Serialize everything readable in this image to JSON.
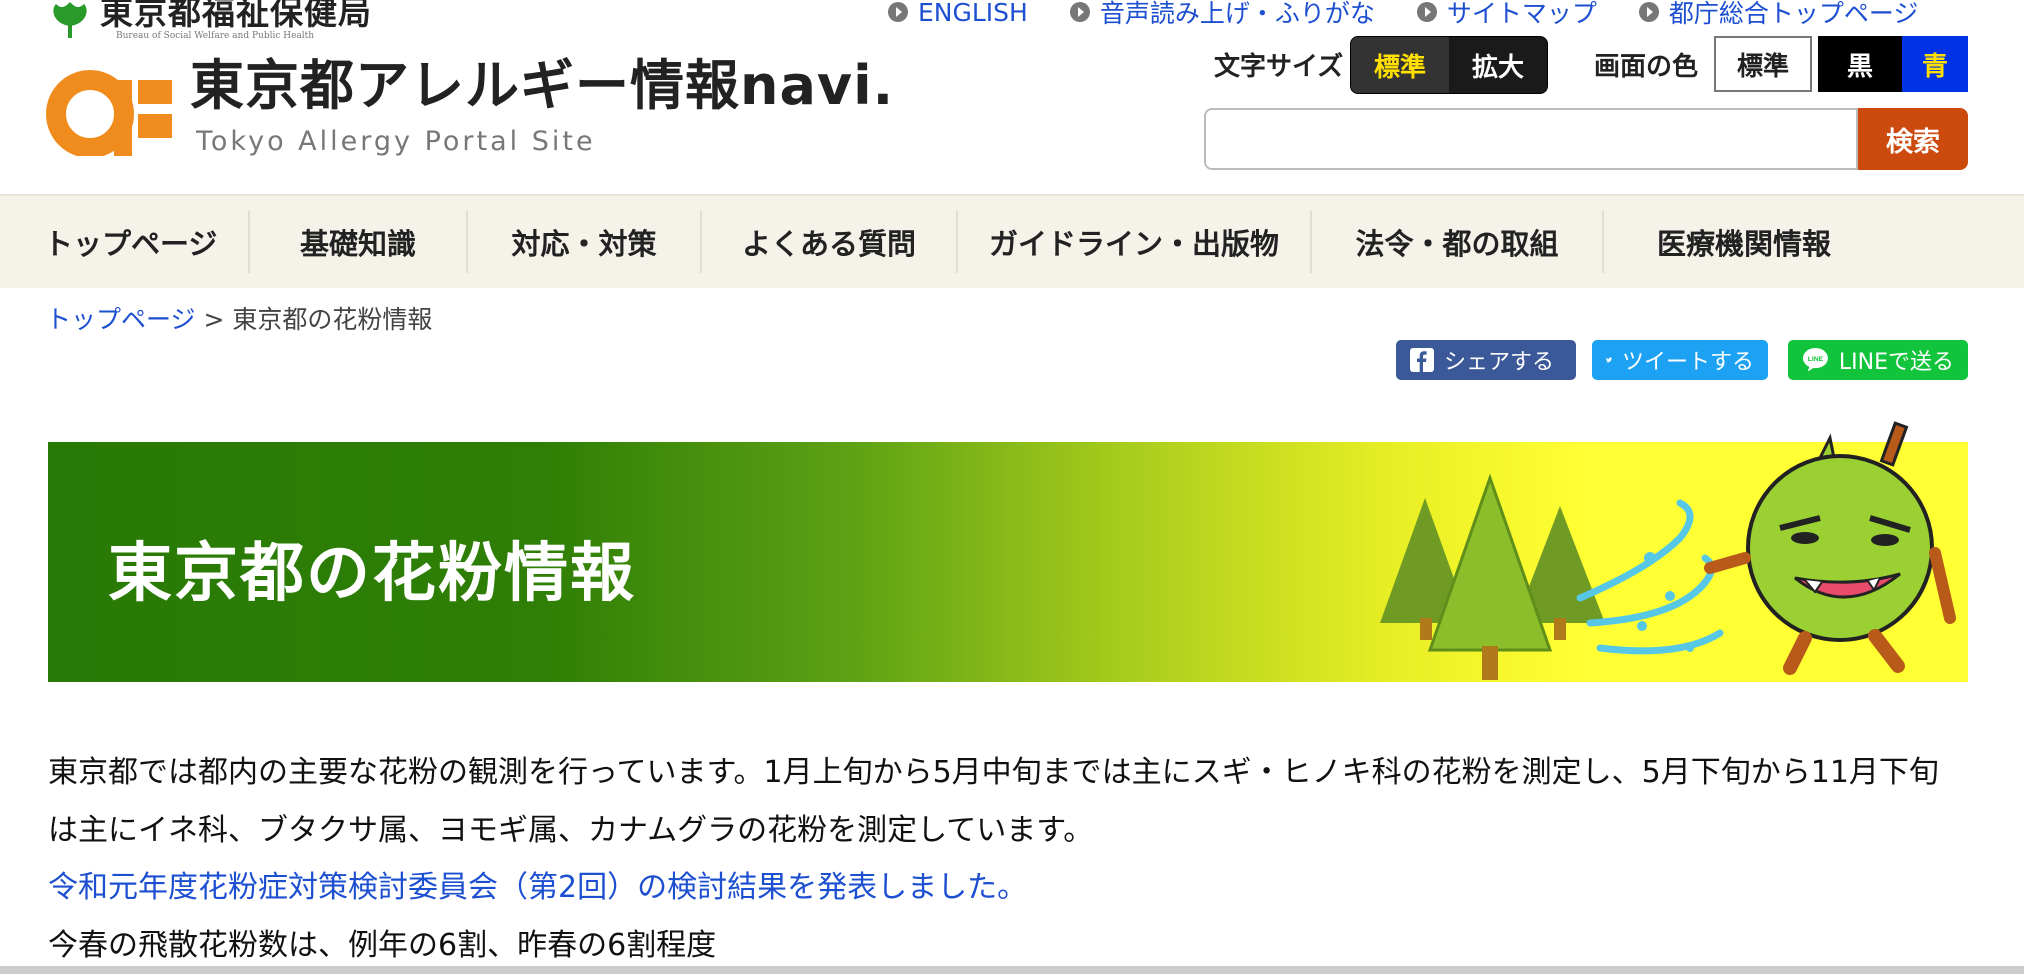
{
  "header": {
    "bureau_name": "東京都福祉保健局",
    "bureau_en": "Bureau of Social Welfare and Public Health",
    "site_title": "東京都アレルギー情報navi.",
    "site_subtitle": "Tokyo Allergy Portal Site",
    "top_links": [
      "ENGLISH",
      "音声読み上げ・ふりがな",
      "サイトマップ",
      "都庁総合トップページ"
    ],
    "font_size": {
      "label": "文字サイズ",
      "standard": "標準",
      "large": "拡大"
    },
    "screen_color": {
      "label": "画面の色",
      "standard": "標準",
      "black": "黒",
      "blue": "青"
    },
    "search": {
      "placeholder": "",
      "button": "検索"
    }
  },
  "nav": {
    "items": [
      "トップページ",
      "基礎知識",
      "対応・対策",
      "よくある質問",
      "ガイドライン・出版物",
      "法令・都の取組",
      "医療機関情報"
    ]
  },
  "breadcrumb": {
    "home": "トップページ",
    "sep": ">",
    "current": "東京都の花粉情報"
  },
  "share": {
    "facebook": "シェアする",
    "twitter": "ツイートする",
    "line": "LINEで送る",
    "line_badge": "LINE"
  },
  "banner": {
    "title": "東京都の花粉情報"
  },
  "content": {
    "intro": "東京都では都内の主要な花粉の観測を行っています。1月上旬から5月中旬までは主にスギ・ヒノキ科の花粉を測定し、5月下旬から11月下旬は主にイネ科、ブタクサ属、ヨモギ属、カナムグラの花粉を測定しています。",
    "link": "令和元年度花粉症対策検討委員会（第2回）の検討結果を発表しました。",
    "summary": "今春の飛散花粉数は、例年の6割、昨春の6割程度"
  },
  "colors": {
    "accent_orange": "#f08c1e",
    "nav_bg": "#f5f2ea",
    "link": "#1d4fd1",
    "search_btn": "#cc4a0e"
  }
}
